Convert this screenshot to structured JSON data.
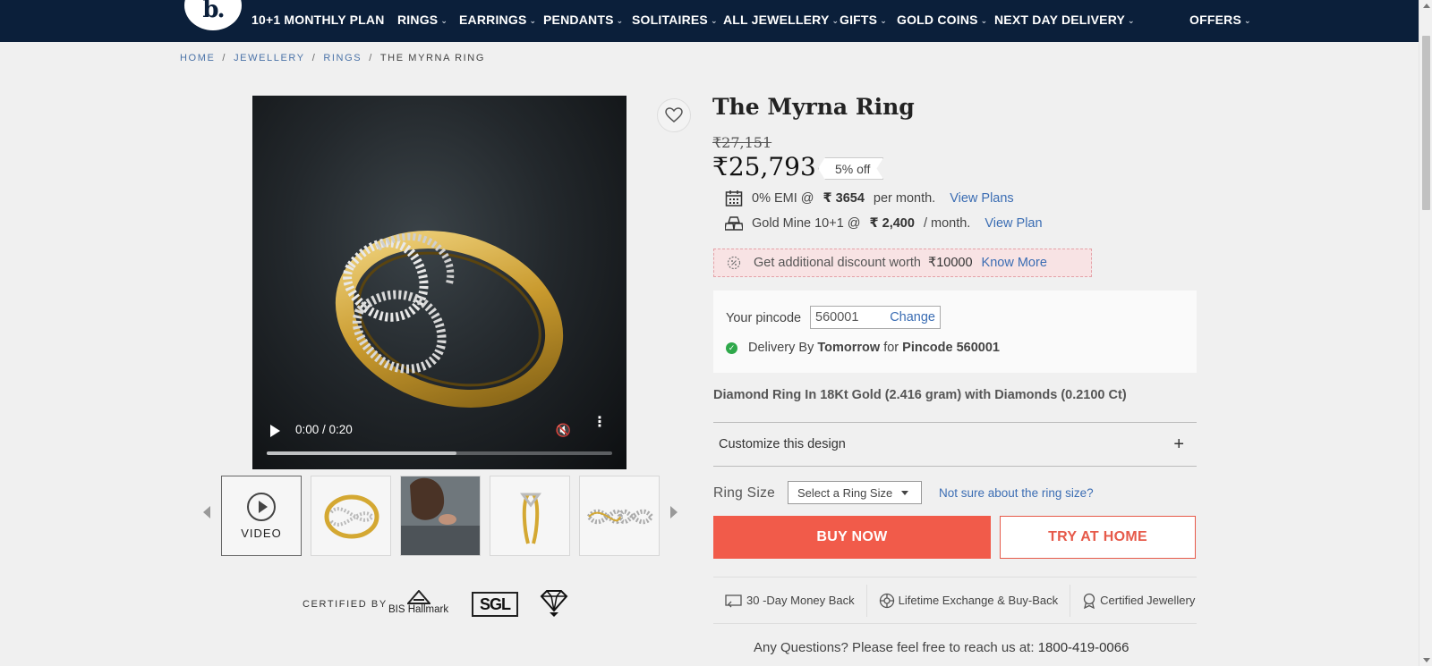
{
  "nav": {
    "logo_text": "b.",
    "items": [
      "10+1 MONTHLY PLAN",
      "RINGS",
      "EARRINGS",
      "PENDANTS",
      "SOLITAIRES",
      "ALL JEWELLERY",
      "GIFTS",
      "GOLD COINS",
      "NEXT DAY DELIVERY",
      "OFFERS"
    ],
    "has_dropdown": [
      false,
      true,
      true,
      true,
      true,
      true,
      true,
      true,
      true,
      true
    ],
    "background": "#0b1f3a"
  },
  "breadcrumb": {
    "items": [
      "HOME",
      "JEWELLERY",
      "RINGS",
      "THE MYRNA RING"
    ],
    "separator": "/"
  },
  "video": {
    "time": "0:00 / 0:20",
    "progress_fraction": 0.55,
    "icons": [
      "play-icon",
      "mute-icon",
      "more-icon"
    ]
  },
  "thumbnails": {
    "video_label": "VIDEO",
    "items": [
      "video",
      "ring-front",
      "model-wearing-ring",
      "ring-side",
      "ring-top"
    ]
  },
  "certified": {
    "label": "CERTIFIED BY",
    "logos": [
      "BIS Hallmark",
      "SGL",
      "IGI-diamond"
    ]
  },
  "product": {
    "title": "The Myrna Ring",
    "old_price": "₹27,151",
    "price": "₹25,793",
    "discount_badge": "5% off",
    "emi_prefix": "0% EMI @",
    "emi_amount": "₹ 3654",
    "emi_suffix": "per month.",
    "emi_link": "View Plans",
    "goldmine_prefix": "Gold Mine 10+1 @",
    "goldmine_amount": "₹ 2,400",
    "goldmine_suffix": "/ month.",
    "goldmine_link": "View Plan",
    "extra_discount_text": "Get additional discount worth",
    "extra_discount_amount": "₹10000",
    "extra_discount_link": "Know More",
    "description": "Diamond Ring In 18Kt Gold (2.416 gram) with Diamonds (0.2100 Ct)"
  },
  "pincode": {
    "label": "Your pincode",
    "value": "560001",
    "change_link": "Change",
    "delivery_prefix": "Delivery By",
    "delivery_when": "Tomorrow",
    "delivery_for": "for",
    "delivery_pincode": "Pincode 560001"
  },
  "customize": {
    "label": "Customize this design",
    "toggle": "+"
  },
  "ring_size": {
    "label": "Ring Size",
    "select_placeholder": "Select a Ring Size",
    "help_link": "Not sure about the ring size?"
  },
  "actions": {
    "buy_now": "BUY NOW",
    "try_at_home": "TRY AT HOME",
    "buy_color": "#f15b4a"
  },
  "assurances": [
    {
      "icon": "money-back-icon",
      "label": "30 -Day Money Back"
    },
    {
      "icon": "exchange-icon",
      "label": "Lifetime Exchange & Buy-Back"
    },
    {
      "icon": "certified-icon",
      "label": "Certified Jewellery"
    }
  ],
  "contact": {
    "text": "Any Questions? Please feel free to reach us at:",
    "phone": "1800-419-0066"
  }
}
